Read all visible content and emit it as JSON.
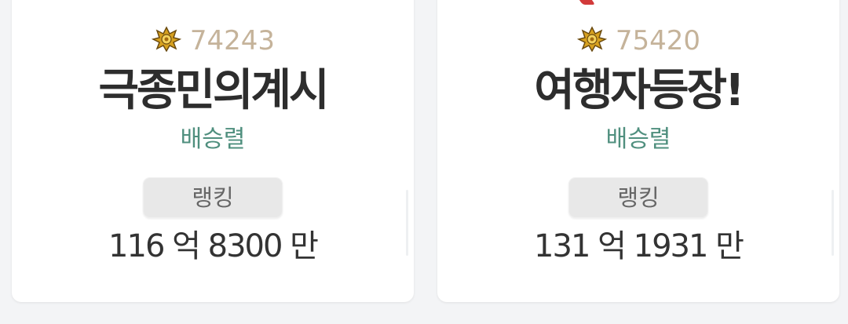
{
  "colors": {
    "background": "#f3f4f6",
    "card": "#ffffff",
    "score": "#c5b39a",
    "title": "#2d2d2d",
    "class_name": "#4f8f7e",
    "badge": "#e8e8e8",
    "power": "#333333"
  },
  "cards": [
    {
      "crest_icon": "gold-emblem-icon",
      "score": "74243",
      "title": "극종민의계시",
      "class_name": "배승렬",
      "rank_label": "랭킹",
      "power": "116 억 8300 만"
    },
    {
      "crest_icon": "gold-emblem-icon",
      "score": "75420",
      "title": "여행자등장!",
      "class_name": "배승렬",
      "rank_label": "랭킹",
      "power": "131 억 1931 만"
    }
  ]
}
